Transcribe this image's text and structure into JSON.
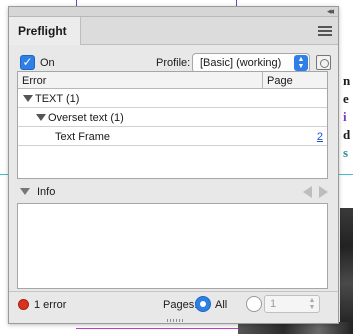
{
  "background": {
    "letters": [
      "n",
      "e",
      "i",
      "d",
      "s"
    ]
  },
  "panel": {
    "collapse_glyph": "◂◂",
    "close_glyph": "×",
    "tab_label": "Preflight",
    "on_checked": true,
    "on_label": "On",
    "profile_label": "Profile:",
    "profile_value": "[Basic] (working)"
  },
  "error_table": {
    "columns": [
      "Error",
      "Page"
    ],
    "rows": [
      {
        "label": "TEXT (1)",
        "indent": 0,
        "expanded": true,
        "page": ""
      },
      {
        "label": "Overset text (1)",
        "indent": 1,
        "expanded": true,
        "page": ""
      },
      {
        "label": "Text Frame",
        "indent": 2,
        "expanded": false,
        "page": "2"
      }
    ]
  },
  "info": {
    "label": "Info"
  },
  "status": {
    "color": "#d9321f",
    "text": "1 error",
    "pages_label": "Pages:",
    "all_label": "All",
    "all_selected": true,
    "range_value": "1"
  },
  "colors": {
    "accent": "#2e80e6",
    "error": "#d9321f",
    "link": "#1a4fd6"
  }
}
